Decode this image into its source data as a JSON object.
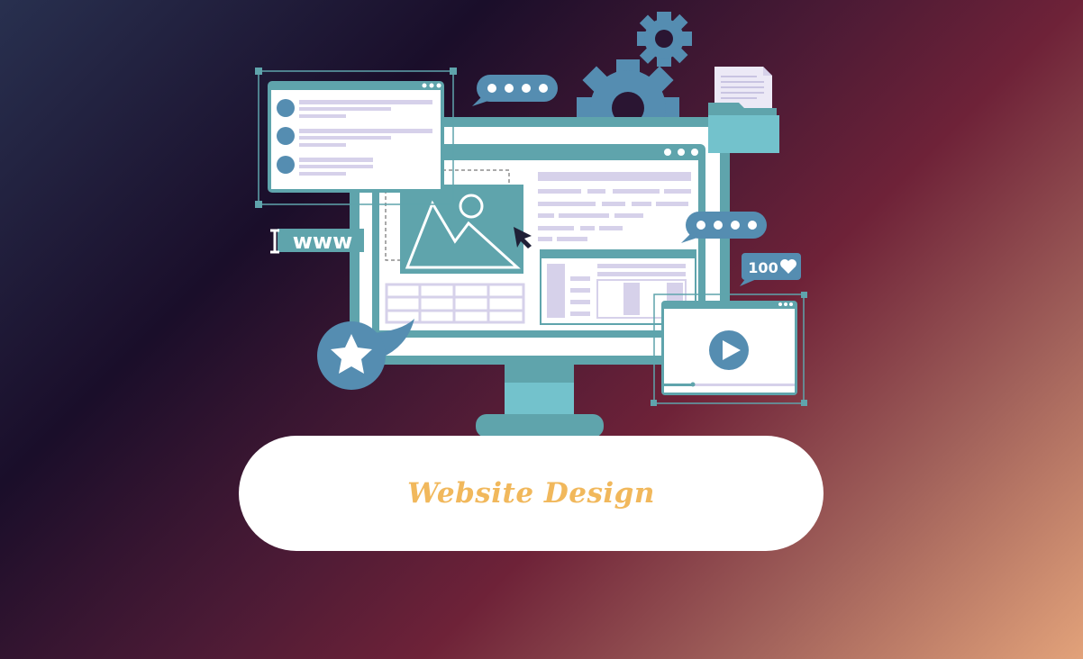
{
  "illustration": {
    "url_text": "www",
    "like_count": "100"
  },
  "pill": {
    "label": "Website Design"
  },
  "colors": {
    "teal": "#5fa4ac",
    "blue": "#558db1",
    "lavender": "#d6d1ea",
    "accent": "#f1b85c"
  },
  "icons": [
    "gear-icon",
    "chat-bubble-icon",
    "folder-icon",
    "image-icon",
    "cursor-icon",
    "heart-icon",
    "play-icon",
    "star-icon",
    "text-cursor-icon"
  ]
}
